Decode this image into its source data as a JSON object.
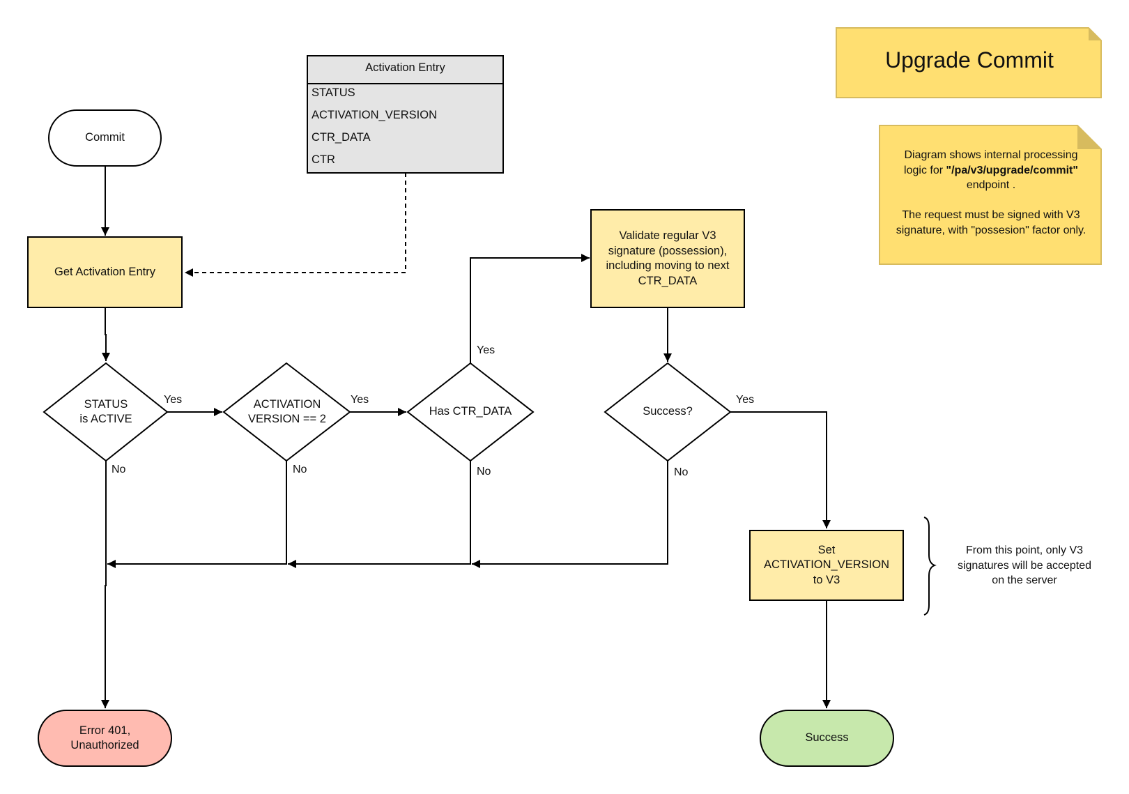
{
  "title_note": {
    "title": "Upgrade Commit",
    "fill": "#ffdf71",
    "stroke": "#d7bb5e"
  },
  "info_note": {
    "line1": "Diagram shows internal processing",
    "line2_prefix": "logic for ",
    "line2_bold": "\"/pa/v3/upgrade/commit\"",
    "line3": "endpoint .",
    "line4": "The request must be signed with V3",
    "line5": "signature, with \"possesion\" factor only."
  },
  "entity": {
    "title": "Activation Entry",
    "fields": [
      "STATUS",
      "ACTIVATION_VERSION",
      "CTR_DATA",
      "CTR"
    ],
    "fill": "#e4e4e4"
  },
  "nodes": {
    "commit": {
      "label": "Commit",
      "fill": "#ffffff"
    },
    "get_activation": {
      "label": "Get Activation Entry",
      "fill": "#ffeca9"
    },
    "status_active": {
      "line1": "STATUS",
      "line2": "is ACTIVE"
    },
    "activation_version": {
      "line1": "ACTIVATION",
      "line2": "VERSION == 2"
    },
    "has_ctr_data": {
      "label": "Has CTR_DATA"
    },
    "validate": {
      "line1": "Validate regular V3",
      "line2": "signature (possession),",
      "line3": "including moving to next",
      "line4": "CTR_DATA",
      "fill": "#ffeca9"
    },
    "success_q": {
      "label": "Success?"
    },
    "set_version": {
      "line1": "Set",
      "line2": "ACTIVATION_VERSION",
      "line3": "to V3",
      "fill": "#ffeca9"
    },
    "error": {
      "line1": "Error 401,",
      "line2": "Unauthorized",
      "fill": "#ffbbb1"
    },
    "success": {
      "label": "Success",
      "fill": "#c7e8ac"
    }
  },
  "edge_labels": {
    "status_yes": "Yes",
    "status_no": "No",
    "version_yes": "Yes",
    "version_no": "No",
    "ctr_yes": "Yes",
    "ctr_no": "No",
    "success_yes": "Yes",
    "success_no": "No"
  },
  "annotation": {
    "line1": "From this point, only V3",
    "line2": "signatures will be accepted",
    "line3": "on the server"
  }
}
